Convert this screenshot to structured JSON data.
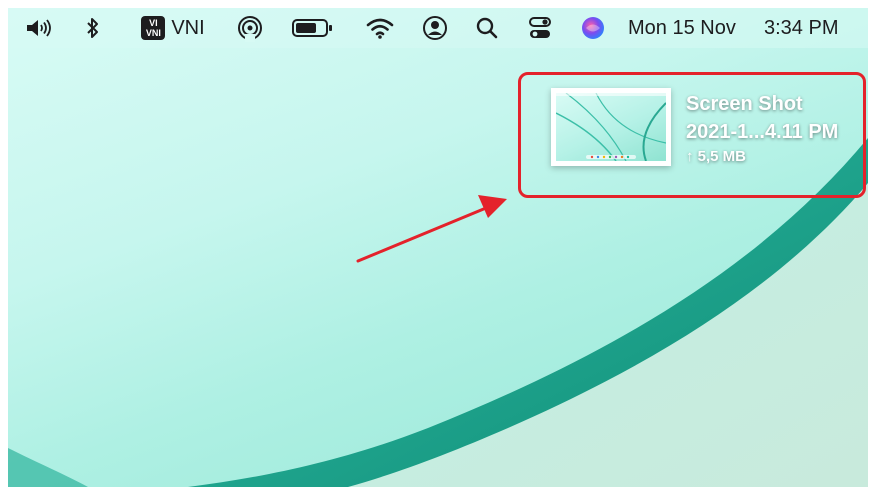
{
  "menubar": {
    "input_source": "VNI",
    "input_badge_top": "VI",
    "input_badge_bottom": "VNI",
    "date": "Mon 15 Nov",
    "time": "3:34 PM",
    "icons": [
      "speaker-icon",
      "bluetooth-icon",
      "vni-input-icon",
      "airdrop-icon",
      "battery-icon",
      "wifi-icon",
      "user-icon",
      "search-icon",
      "control-center-icon",
      "siri-icon"
    ]
  },
  "screenshot_preview": {
    "title_line1": "Screen Shot",
    "title_line2": "2021-1...4.11 PM",
    "size": "↑ 5,5 MB"
  },
  "colors": {
    "highlight": "#e4222b",
    "wallpaper_light": "#d8fbf5",
    "wallpaper_dark": "#2aa892"
  }
}
